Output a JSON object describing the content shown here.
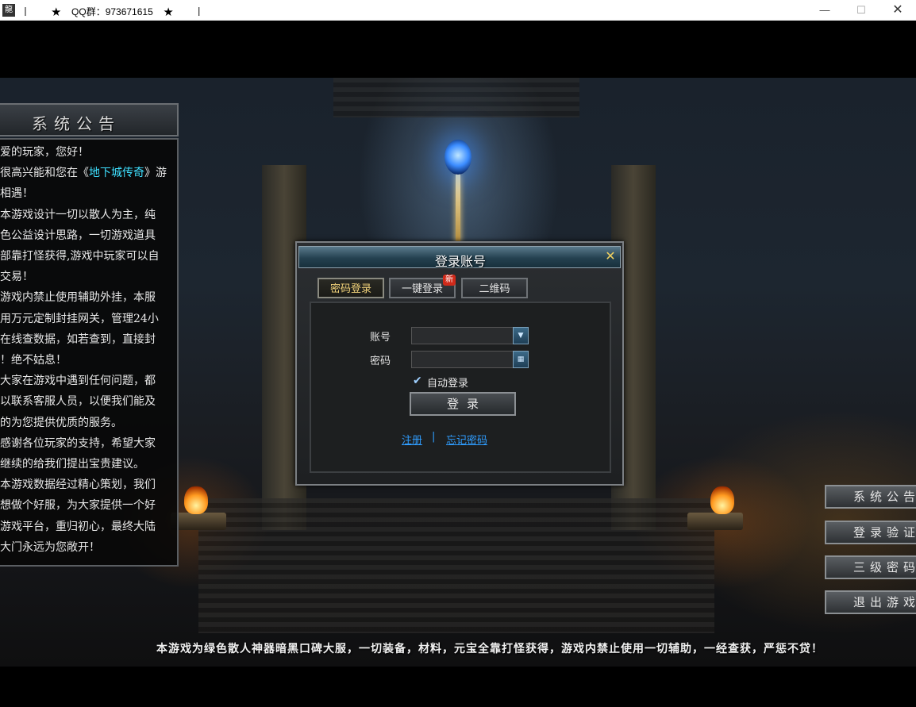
{
  "window": {
    "title": "★    QQ群：973671615    ★",
    "cursor_bar_left": "丨",
    "cursor_bar_right": "丨",
    "app_icon": "game-app-icon",
    "controls": {
      "minimize": "—",
      "maximize": "☐",
      "close": "✕"
    }
  },
  "notice": {
    "title": "系统公告",
    "lines": [
      "爱的玩家，您好！",
      "很高兴能和您在《",
      "相遇！",
      "本游戏设计一切以散人为主，纯",
      "色公益设计思路，一切游戏道具",
      "部靠打怪获得,游戏中玩家可以自",
      "交易！",
      "游戏内禁止使用辅助外挂，本服",
      "用万元定制封挂网关，管理24小",
      "在线查数据，如若查到，直接封",
      "！绝不姑息！",
      "大家在游戏中遇到任何问题，都",
      "以联系客服人员，以便我们能及",
      "的为您提供优质的服务。",
      " 感谢各位玩家的支持，希望大家",
      "继续的给我们提出宝贵建议。",
      " 本游戏数据经过精心策划，我们",
      "想做个好服，为大家提供一个好",
      "游戏平台，重归初心，最终大陆",
      "大门永远为您敞开！"
    ],
    "highlight_game_name": "地下城传奇",
    "line2_suffix": "》游"
  },
  "login": {
    "title": "登录账号",
    "close_label": "✕",
    "tabs": [
      {
        "label": "密码登录",
        "active": true
      },
      {
        "label": "一键登录",
        "active": false
      },
      {
        "label": "二维码",
        "active": false
      }
    ],
    "new_badge": "新",
    "account_label": "账号",
    "account_value": "",
    "password_label": "密码",
    "password_value": "",
    "auto_login_label": "自动登录",
    "auto_login_checked": true,
    "login_button": "登录",
    "register_link": "注册",
    "link_separator": "|",
    "forgot_link": "忘记密码"
  },
  "side_menu": [
    "系统公告",
    "登录验证",
    "三级密码",
    "退出游戏"
  ],
  "banner": "本游戏为绿色散人神器暗黑口碑大服，一切装备，材料，元宝全靠打怪获得，游戏内禁止使用一切辅助，一经查获，严惩不贷！",
  "colors": {
    "highlight": "#3fe0ff",
    "link": "#2f9dff",
    "active_tab": "#f2d37a",
    "badge": "#d02a1a"
  }
}
